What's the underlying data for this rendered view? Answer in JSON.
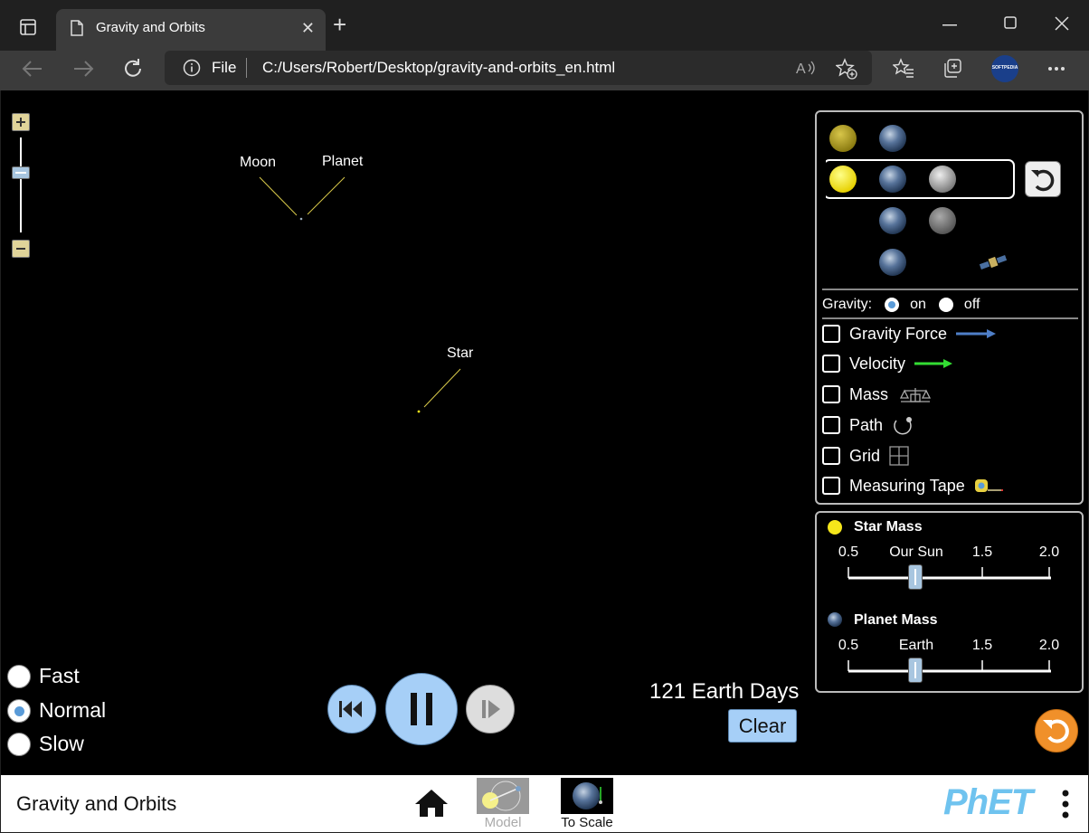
{
  "browser": {
    "tab_title": "Gravity and Orbits",
    "address_scheme": "File",
    "url": "C:/Users/Robert/Desktop/gravity-and-orbits_en.html",
    "profile_label": "SOFTPEDIA"
  },
  "sim": {
    "labels": {
      "moon": "Moon",
      "planet": "Planet",
      "star": "Star"
    },
    "gravity": {
      "label": "Gravity:",
      "on": "on",
      "off": "off",
      "selected": "on"
    },
    "checkboxes": [
      {
        "label": "Gravity Force",
        "checked": false
      },
      {
        "label": "Velocity",
        "checked": false
      },
      {
        "label": "Mass",
        "checked": false
      },
      {
        "label": "Path",
        "checked": false
      },
      {
        "label": "Grid",
        "checked": false
      },
      {
        "label": "Measuring Tape",
        "checked": false
      }
    ],
    "star_mass": {
      "title": "Star Mass",
      "ticks": [
        "0.5",
        "Our Sun",
        "1.5",
        "2.0"
      ],
      "value": 1.0
    },
    "planet_mass": {
      "title": "Planet Mass",
      "ticks": [
        "0.5",
        "Earth",
        "1.5",
        "2.0"
      ],
      "value": 1.0
    },
    "speed": {
      "options": [
        "Fast",
        "Normal",
        "Slow"
      ],
      "selected": "Normal"
    },
    "elapsed": "121 Earth Days",
    "clear_label": "Clear",
    "colors": {
      "gravity_arrow": "#4f7fc8",
      "velocity_arrow": "#33dd33",
      "button_blue": "#a6cff7",
      "sun": "#f5e61b"
    }
  },
  "bottom": {
    "sim_title": "Gravity and Orbits",
    "screens": [
      "Model",
      "To Scale"
    ],
    "selected_screen": "To Scale",
    "logo": "PhET"
  }
}
